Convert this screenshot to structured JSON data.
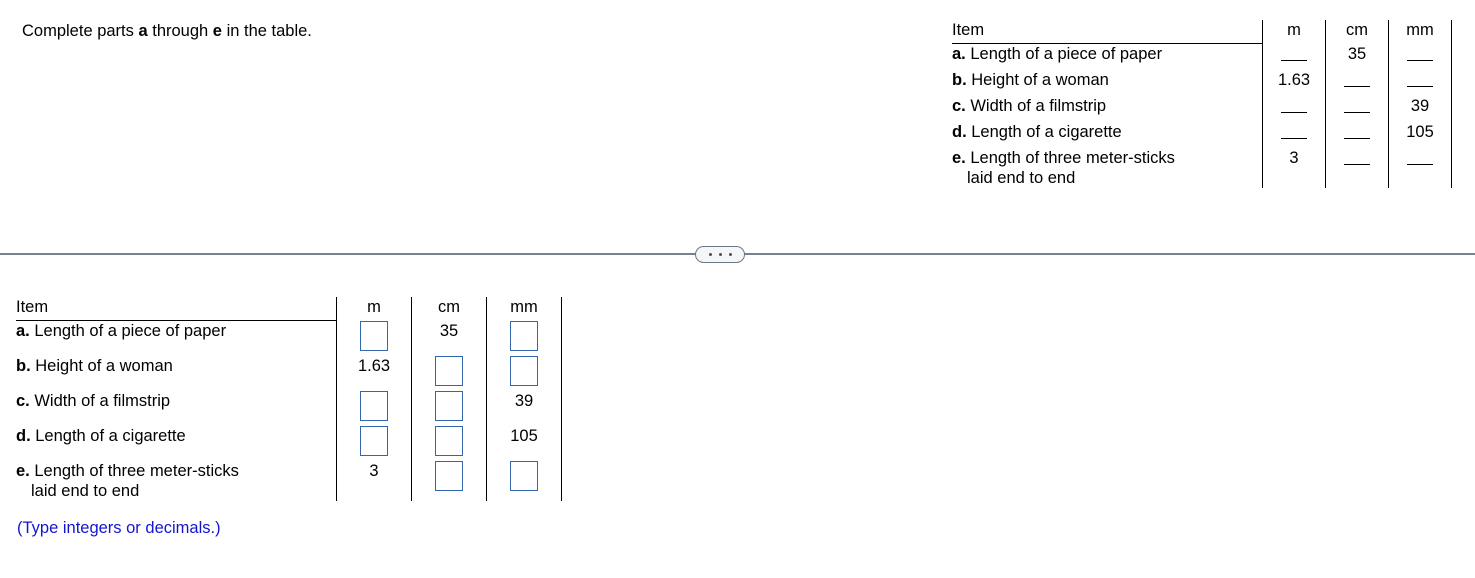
{
  "prompt": {
    "text_before": "Complete parts ",
    "bold_a": "a",
    "text_middle": " through ",
    "bold_e": "e",
    "text_after": " in the table."
  },
  "colors": {
    "answer_box_border": "#3366aa",
    "hint_text": "#1515cf",
    "divider": "#78818f",
    "pill_border": "#6e7787",
    "pill_fill": "#f4f6f8",
    "table_rule": "#000000"
  },
  "divider": {
    "expand_button_label": "•••",
    "dots": [
      "dot",
      "dot",
      "dot"
    ]
  },
  "table_headers": {
    "item": "Item",
    "m": "m",
    "cm": "cm",
    "mm": "mm"
  },
  "top_table": {
    "rows": [
      {
        "letter": "a.",
        "label": "Length of a piece of paper",
        "sub": "",
        "m": "",
        "cm": "35",
        "mm": ""
      },
      {
        "letter": "b.",
        "label": "Height of a woman",
        "sub": "",
        "m": "1.63",
        "cm": "",
        "mm": ""
      },
      {
        "letter": "c.",
        "label": "Width of a filmstrip",
        "sub": "",
        "m": "",
        "cm": "",
        "mm": "39"
      },
      {
        "letter": "d.",
        "label": "Length of a cigarette",
        "sub": "",
        "m": "",
        "cm": "",
        "mm": "105"
      },
      {
        "letter": "e.",
        "label": "Length of three meter-sticks",
        "sub": "laid end to end",
        "m": "3",
        "cm": "",
        "mm": ""
      }
    ]
  },
  "bottom_table": {
    "rows": [
      {
        "letter": "a.",
        "label": "Length of a piece of paper",
        "sub": "",
        "m": "",
        "m_input": true,
        "m_value": "",
        "cm": "35",
        "cm_input": false,
        "cm_value": "",
        "mm": "",
        "mm_input": true,
        "mm_value": ""
      },
      {
        "letter": "b.",
        "label": "Height of a woman",
        "sub": "",
        "m": "1.63",
        "m_input": false,
        "m_value": "",
        "cm": "",
        "cm_input": true,
        "cm_value": "",
        "mm": "",
        "mm_input": true,
        "mm_value": ""
      },
      {
        "letter": "c.",
        "label": "Width of a filmstrip",
        "sub": "",
        "m": "",
        "m_input": true,
        "m_value": "",
        "cm": "",
        "cm_input": true,
        "cm_value": "",
        "mm": "39",
        "mm_input": false,
        "mm_value": ""
      },
      {
        "letter": "d.",
        "label": "Length of a cigarette",
        "sub": "",
        "m": "",
        "m_input": true,
        "m_value": "",
        "cm": "",
        "cm_input": true,
        "cm_value": "",
        "mm": "105",
        "mm_input": false,
        "mm_value": ""
      },
      {
        "letter": "e.",
        "label": "Length of three meter-sticks",
        "sub": "laid end to end",
        "m": "3",
        "m_input": false,
        "m_value": "",
        "cm": "",
        "cm_input": true,
        "cm_value": "",
        "mm": "",
        "mm_input": true,
        "mm_value": ""
      }
    ]
  },
  "hint": "(Type integers or decimals.)"
}
